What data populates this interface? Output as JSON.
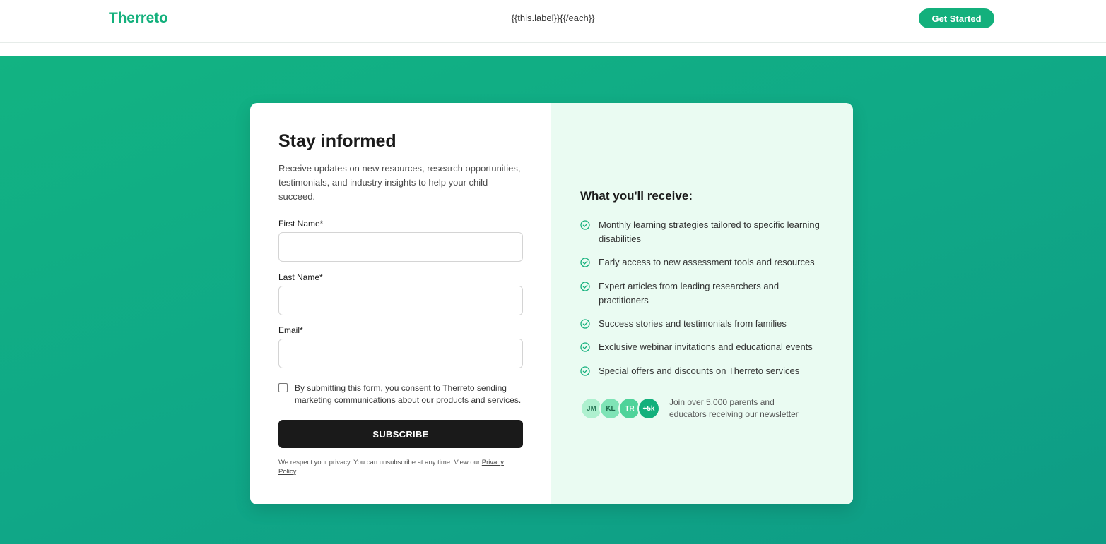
{
  "nav": {
    "brand": "Therreto",
    "links_placeholder": "{{this.label}}{{/each}}",
    "cta": "Get Started"
  },
  "form": {
    "title": "Stay informed",
    "description": "Receive updates on new resources, research opportunities, testimonials, and industry insights to help your child succeed.",
    "fields": {
      "first_name": {
        "label": "First Name*",
        "value": ""
      },
      "last_name": {
        "label": "Last Name*",
        "value": ""
      },
      "email": {
        "label": "Email*",
        "value": ""
      }
    },
    "consent": "By submitting this form, you consent to Therreto sending marketing communications about our products and services.",
    "consent_checked": false,
    "submit": "SUBSCRIBE",
    "privacy_prefix": "We respect your privacy. You can unsubscribe at any time. View our ",
    "privacy_link": "Privacy Policy",
    "privacy_suffix": "."
  },
  "benefits": {
    "title": "What you'll receive:",
    "items": [
      "Monthly learning strategies tailored to specific learning disabilities",
      "Early access to new assessment tools and resources",
      "Expert articles from leading researchers and practitioners",
      "Success stories and testimonials from families",
      "Exclusive webinar invitations and educational events",
      "Special offers and discounts on Therreto services"
    ],
    "avatars": [
      "JM",
      "KL",
      "TR",
      "+5k"
    ],
    "social_proof": "Join over 5,000 parents and educators receiving our newsletter"
  },
  "colors": {
    "brand": "#13b07c",
    "hero_start": "#12b382",
    "hero_end": "#0e9c85",
    "panel": "#eafbf2",
    "button_dark": "#1a1a1a",
    "avatar_1": "#aef0cf",
    "avatar_2": "#7fe3b6",
    "avatar_3": "#4fd39a",
    "avatar_4": "#13b07c"
  }
}
